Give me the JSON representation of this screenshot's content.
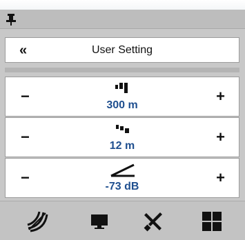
{
  "header": {
    "back_label": "«",
    "title": "User Setting"
  },
  "controls": [
    {
      "minus_label": "−",
      "plus_label": "+",
      "value": "300 m",
      "icon": "range-bars-icon"
    },
    {
      "minus_label": "−",
      "plus_label": "+",
      "value": "12 m",
      "icon": "step-bars-icon"
    },
    {
      "minus_label": "−",
      "plus_label": "+",
      "value": "-73 dB",
      "icon": "gain-ramp-icon"
    }
  ],
  "toolbar": {
    "icons": [
      "sonar-icon",
      "display-icon",
      "tools-icon",
      "layout-grid-icon"
    ]
  },
  "colors": {
    "panel_bg": "#c8c8c8",
    "value_text": "#1f4f8f",
    "row_border": "#9b9b9b"
  }
}
